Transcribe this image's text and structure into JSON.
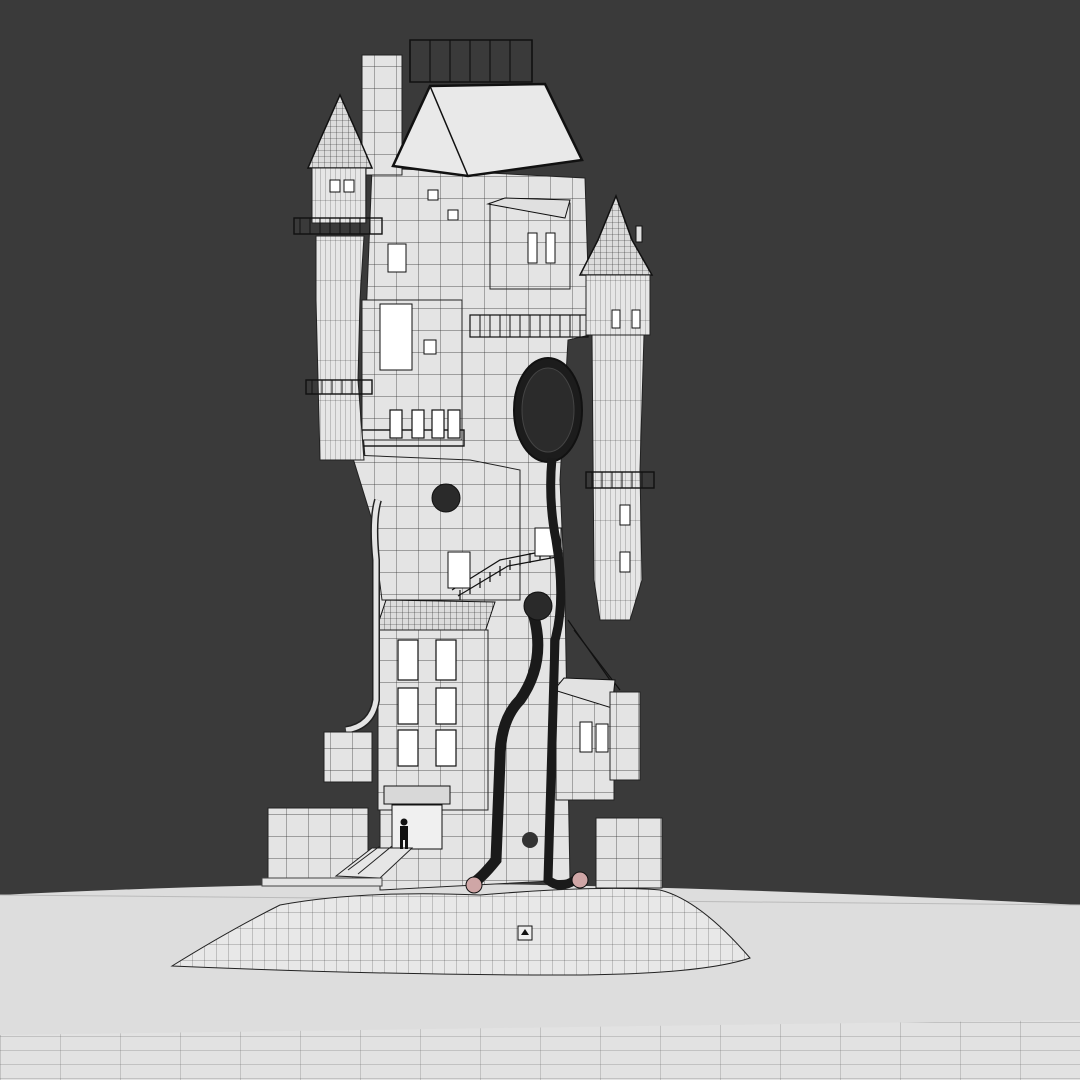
{
  "app": {
    "view": "3d-viewport",
    "shading": "solid-wireframe",
    "colors": {
      "background": "#3a3a3a",
      "mesh_face": "#e6e6e6",
      "ground_face": "#dcdcdc",
      "wire": "#1a1a1a"
    }
  },
  "scene": {
    "objects": [
      {
        "name": "tower",
        "icon": "tower-mesh"
      },
      {
        "name": "left-turret",
        "icon": "turret-mesh"
      },
      {
        "name": "right-turret",
        "icon": "turret-mesh"
      },
      {
        "name": "rock-base",
        "icon": "terrain-mesh"
      },
      {
        "name": "ground-plane",
        "icon": "plane-mesh"
      },
      {
        "name": "human-figure",
        "icon": "person-silhouette-icon"
      },
      {
        "name": "round-window",
        "icon": "round-window-icon"
      },
      {
        "name": "pipes",
        "icon": "pipe-icon"
      }
    ]
  }
}
